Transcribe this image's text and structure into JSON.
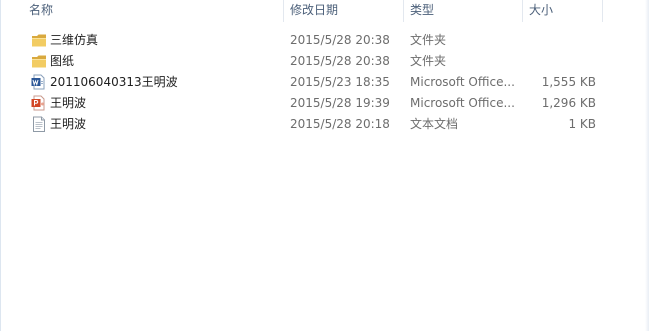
{
  "columns": {
    "name": "名称",
    "date": "修改日期",
    "type": "类型",
    "size": "大小"
  },
  "files": [
    {
      "name": "三维仿真",
      "date": "2015/5/28 20:38",
      "type": "文件夹",
      "size": "",
      "icon": "folder-icon"
    },
    {
      "name": "图纸",
      "date": "2015/5/28 20:38",
      "type": "文件夹",
      "size": "",
      "icon": "folder-icon"
    },
    {
      "name": "201106040313王明波",
      "date": "2015/5/23 18:35",
      "type": "Microsoft Office...",
      "size": "1,555 KB",
      "icon": "word-document-icon"
    },
    {
      "name": "王明波",
      "date": "2015/5/28 19:39",
      "type": "Microsoft Office...",
      "size": "1,296 KB",
      "icon": "powerpoint-document-icon"
    },
    {
      "name": "王明波",
      "date": "2015/5/28 20:18",
      "type": "文本文档",
      "size": "1 KB",
      "icon": "text-document-icon"
    }
  ],
  "colors": {
    "header_text": "#4c607a",
    "folder": "#e8c15a",
    "word": "#2b5797",
    "powerpoint": "#d24726"
  }
}
